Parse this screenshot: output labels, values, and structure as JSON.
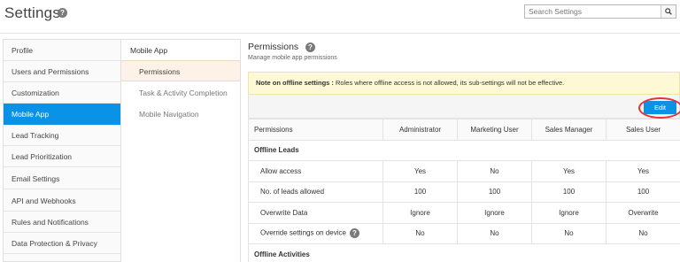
{
  "header": {
    "title": "Settings",
    "search_placeholder": "Search Settings"
  },
  "left_nav": {
    "items": [
      {
        "label": "Profile"
      },
      {
        "label": "Users and Permissions"
      },
      {
        "label": "Customization"
      },
      {
        "label": "Mobile App"
      },
      {
        "label": "Lead Tracking"
      },
      {
        "label": "Lead Prioritization"
      },
      {
        "label": "Email Settings"
      },
      {
        "label": "API and Webhooks"
      },
      {
        "label": "Rules and Notifications"
      },
      {
        "label": "Data Protection & Privacy"
      }
    ],
    "active": "Mobile App"
  },
  "sub_nav": {
    "header": "Mobile App",
    "items": [
      {
        "label": "Permissions"
      },
      {
        "label": "Task & Activity Completion"
      },
      {
        "label": "Mobile Navigation"
      }
    ],
    "active": "Permissions"
  },
  "main": {
    "title": "Permissions",
    "subtitle": "Manage mobile app permissions",
    "note_label": "Note on offline settings :",
    "note_text": "Roles where offline access is not allowed, its sub-settings will not be effective.",
    "edit_label": "Edit"
  },
  "table": {
    "columns": [
      "Permissions",
      "Administrator",
      "Marketing User",
      "Sales Manager",
      "Sales User"
    ],
    "groups": [
      {
        "name": "Offline Leads",
        "rows": [
          {
            "label": "Allow access",
            "values": [
              "Yes",
              "No",
              "Yes",
              "Yes"
            ]
          },
          {
            "label": "No. of leads allowed",
            "values": [
              "100",
              "100",
              "100",
              "100"
            ]
          },
          {
            "label": "Overwrite Data",
            "values": [
              "Ignore",
              "Ignore",
              "Ignore",
              "Overwrite"
            ]
          },
          {
            "label": "Override settings on device",
            "values": [
              "No",
              "No",
              "No",
              "No"
            ]
          }
        ]
      },
      {
        "name": "Offline Activities",
        "rows": []
      }
    ]
  },
  "colors": {
    "accent": "#0a93e6",
    "note_bg": "#fdf9d4",
    "highlight_ring": "#e53232",
    "submenu_active_bg": "#fdf2e7"
  }
}
